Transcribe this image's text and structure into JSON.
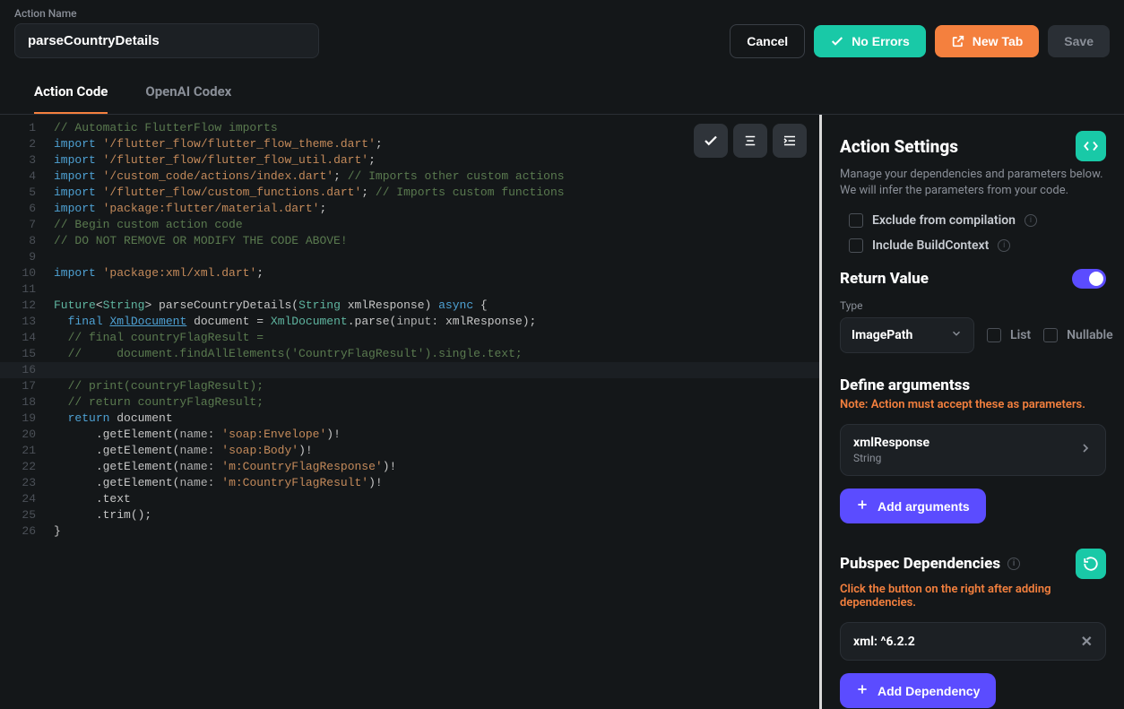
{
  "header": {
    "fieldLabel": "Action Name",
    "actionName": "parseCountryDetails",
    "cancel": "Cancel",
    "noErrors": "No Errors",
    "newTab": "New Tab",
    "save": "Save"
  },
  "tabs": {
    "code": "Action Code",
    "codex": "OpenAI Codex"
  },
  "code": [
    {
      "n": 1,
      "t": "comment",
      "s": "// Automatic FlutterFlow imports"
    },
    {
      "n": 2,
      "t": "import",
      "path": "'/flutter_flow/flutter_flow_theme.dart'"
    },
    {
      "n": 3,
      "t": "import",
      "path": "'/flutter_flow/flutter_flow_util.dart'"
    },
    {
      "n": 4,
      "t": "import",
      "path": "'/custom_code/actions/index.dart'",
      "cmt": "// Imports other custom actions"
    },
    {
      "n": 5,
      "t": "import",
      "path": "'/flutter_flow/custom_functions.dart'",
      "cmt": "// Imports custom functions"
    },
    {
      "n": 6,
      "t": "import",
      "path": "'package:flutter/material.dart'"
    },
    {
      "n": 7,
      "t": "comment",
      "s": "// Begin custom action code"
    },
    {
      "n": 8,
      "t": "comment",
      "s": "// DO NOT REMOVE OR MODIFY THE CODE ABOVE!"
    },
    {
      "n": 9,
      "t": "blank"
    },
    {
      "n": 10,
      "t": "import",
      "path": "'package:xml/xml.dart'"
    },
    {
      "n": 11,
      "t": "blank"
    },
    {
      "n": 12,
      "t": "sig",
      "a": "Future",
      "b": "String",
      "c": "parseCountryDetails",
      "d": "String",
      "e": "xmlResponse",
      "f": "async"
    },
    {
      "n": 13,
      "t": "decl",
      "kw": "final",
      "cls": "XmlDocument",
      "v": " document = ",
      "cls2": "XmlDocument",
      ".m": ".parse(",
      "param": "input:",
      "rest": " xmlResponse);"
    },
    {
      "n": 14,
      "t": "comment",
      "s": "  // final countryFlagResult ="
    },
    {
      "n": 15,
      "t": "comment",
      "s": "  //     document.findAllElements('CountryFlagResult').single.text;"
    },
    {
      "n": 16,
      "t": "blank"
    },
    {
      "n": 17,
      "t": "comment",
      "s": "  // print(countryFlagResult);"
    },
    {
      "n": 18,
      "t": "comment",
      "s": "  // return countryFlagResult;"
    },
    {
      "n": 19,
      "t": "return"
    },
    {
      "n": 20,
      "t": "get",
      "val": "'soap:Envelope'"
    },
    {
      "n": 21,
      "t": "get",
      "val": "'soap:Body'"
    },
    {
      "n": 22,
      "t": "get",
      "val": "'m:CountryFlagResponse'"
    },
    {
      "n": 23,
      "t": "get",
      "val": "'m:CountryFlagResult'"
    },
    {
      "n": 24,
      "t": "text"
    },
    {
      "n": 25,
      "t": "trim"
    },
    {
      "n": 26,
      "t": "close"
    }
  ],
  "settings": {
    "title": "Action Settings",
    "sub": "Manage your dependencies and parameters below. We will infer the parameters from your code.",
    "exclude": "Exclude from compilation",
    "include": "Include BuildContext",
    "returnTitle": "Return Value",
    "typeLabel": "Type",
    "typeValue": "ImagePath",
    "listLabel": "List",
    "nullableLabel": "Nullable",
    "defineTitle": "Define argumentss",
    "defineNote": "Note: Action must accept these as parameters.",
    "arg": {
      "name": "xmlResponse",
      "type": "String"
    },
    "addArgs": "Add arguments",
    "depsTitle": "Pubspec Dependencies",
    "depsNote": "Click the button on the right after adding dependencies.",
    "depValue": "xml: ^6.2.2",
    "addDep": "Add Dependency"
  }
}
